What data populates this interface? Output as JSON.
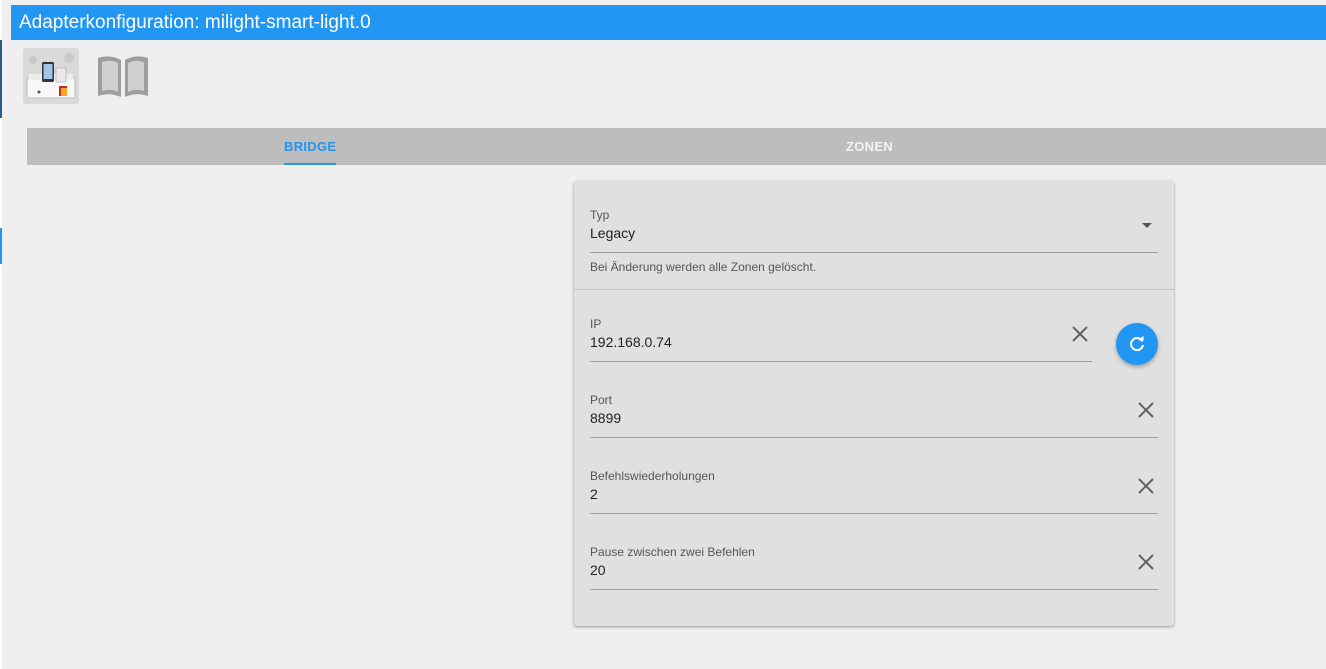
{
  "window": {
    "title": "Adapterkonfiguration: milight-smart-light.0"
  },
  "header": {
    "logo_icon": "milight-bridge-logo",
    "manual_icon": "open-book-icon"
  },
  "tabs": [
    {
      "label": "BRIDGE",
      "active": true
    },
    {
      "label": "ZONEN",
      "active": false
    }
  ],
  "form": {
    "type": {
      "label": "Typ",
      "value": "Legacy",
      "helper": "Bei Änderung werden alle Zonen gelöscht."
    },
    "ip": {
      "label": "IP",
      "value": "192.168.0.74"
    },
    "port": {
      "label": "Port",
      "value": "8899"
    },
    "repeats": {
      "label": "Befehlswiederholungen",
      "value": "2"
    },
    "pause": {
      "label": "Pause zwischen zwei Befehlen",
      "value": "20"
    }
  },
  "colors": {
    "accent": "#2196f3",
    "background": "#efefef",
    "card": "#e0e0e0",
    "tabbar": "#bdbdbd"
  }
}
